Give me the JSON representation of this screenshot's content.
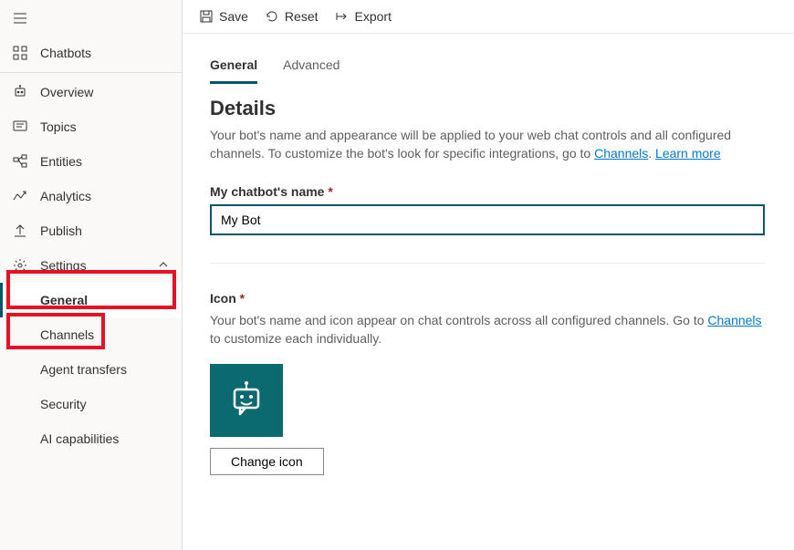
{
  "sidebar": {
    "items": {
      "chatbots": "Chatbots",
      "overview": "Overview",
      "topics": "Topics",
      "entities": "Entities",
      "analytics": "Analytics",
      "publish": "Publish",
      "settings": "Settings"
    },
    "sub_items": {
      "general": "General",
      "channels": "Channels",
      "agent_transfers": "Agent transfers",
      "security": "Security",
      "ai_capabilities": "AI capabilities"
    }
  },
  "toolbar": {
    "save": "Save",
    "reset": "Reset",
    "export": "Export"
  },
  "tabs": {
    "general": "General",
    "advanced": "Advanced"
  },
  "details": {
    "title": "Details",
    "description_pre": "Your bot's name and appearance will be applied to your web chat controls and all configured channels. To customize the bot's look for specific integrations, go to ",
    "channels_link": "Channels",
    "learn_more": "Learn more",
    "name_label": "My chatbot's name",
    "name_value": "My Bot",
    "icon_label": "Icon",
    "icon_description_pre": "Your bot's name and icon appear on chat controls across all configured channels. Go to ",
    "icon_description_post": " to customize each individually.",
    "change_icon": "Change icon"
  }
}
